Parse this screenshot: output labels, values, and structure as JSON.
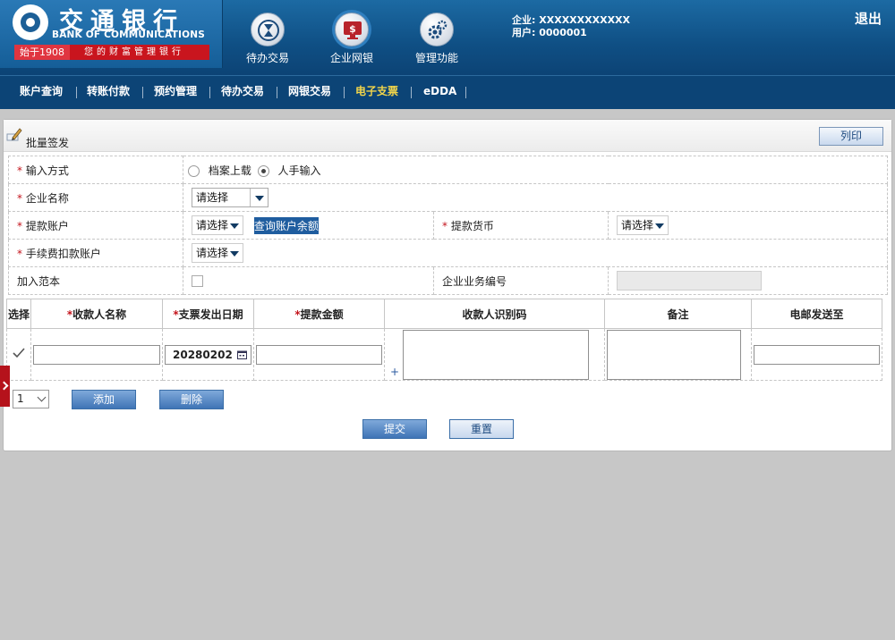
{
  "brand": {
    "name_cn": "交通银行",
    "name_en": "BANK OF COMMUNICATIONS",
    "year": "始于1908",
    "slogan": "您的财富管理银行"
  },
  "top_icons": [
    {
      "label": "待办交易",
      "icon": "hourglass-icon"
    },
    {
      "label": "企业网银",
      "icon": "monitor-dollar-icon"
    },
    {
      "label": "管理功能",
      "icon": "gears-icon"
    }
  ],
  "user": {
    "company_label": "企业:",
    "company": "XXXXXXXXXXXX",
    "user_label": "用户:",
    "user_id": "0000001"
  },
  "logout": "退出",
  "nav": [
    "账户查询",
    "转账付款",
    "预约管理",
    "待办交易",
    "网银交易",
    "电子支票",
    "eDDA"
  ],
  "nav_active_index": 5,
  "page": {
    "title": "批量签发",
    "print_label": "列印"
  },
  "form": {
    "input_method_label": "输入方式",
    "option_upload": "档案上载",
    "option_manual": "人手输入",
    "company_name_label": "企业名称",
    "company_name_value": "请选择",
    "draw_account_label": "提款账户",
    "draw_account_value": "请选择",
    "query_balance": "查询账户余额",
    "draw_currency_label": "提款货币",
    "draw_currency_value": "请选择",
    "fee_account_label": "手续费扣款账户",
    "fee_account_value": "请选择",
    "add_template_label": "加入范本",
    "biz_no_label": "企业业务编号",
    "required_mark": "*"
  },
  "grid": {
    "headers": [
      "选择",
      "收款人名称",
      "支票发出日期",
      "提款金额",
      "收款人识别码",
      "备注",
      "电邮发送至"
    ],
    "required": [
      false,
      true,
      true,
      true,
      false,
      false,
      false
    ],
    "row": {
      "date_value": "20280202",
      "plus": "+"
    }
  },
  "controls": {
    "count_value": "1",
    "add_label": "添加",
    "delete_label": "删除",
    "submit_label": "提交",
    "reset_label": "重置"
  }
}
